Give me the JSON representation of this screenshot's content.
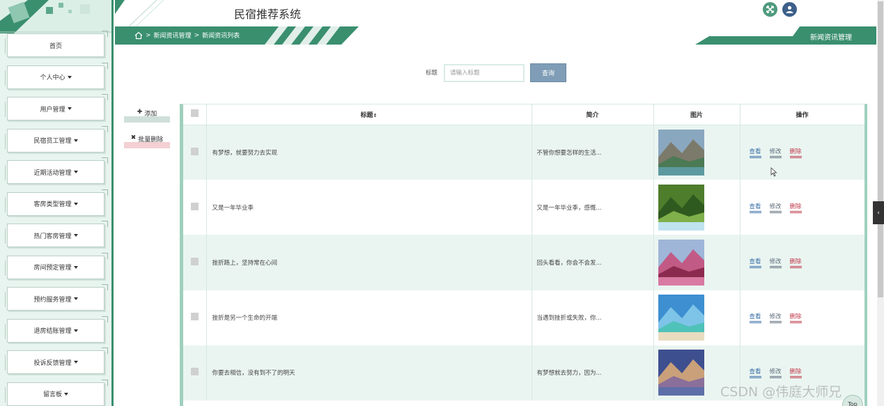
{
  "header": {
    "site_title": "民宿推荐系统",
    "section_label": "新闻资讯管理"
  },
  "breadcrumb": {
    "sep": ">",
    "items": [
      "新闻资讯管理",
      "新闻资讯列表"
    ]
  },
  "sidebar": {
    "items": [
      {
        "label": "首页",
        "has_dropdown": false
      },
      {
        "label": "个人中心",
        "has_dropdown": true
      },
      {
        "label": "用户管理",
        "has_dropdown": true
      },
      {
        "label": "民宿员工管理",
        "has_dropdown": true
      },
      {
        "label": "近期活动管理",
        "has_dropdown": true
      },
      {
        "label": "客房类型管理",
        "has_dropdown": true
      },
      {
        "label": "热门客房管理",
        "has_dropdown": true
      },
      {
        "label": "房间预定管理",
        "has_dropdown": true
      },
      {
        "label": "预约服务管理",
        "has_dropdown": true
      },
      {
        "label": "退房结账管理",
        "has_dropdown": true
      },
      {
        "label": "投诉反馈管理",
        "has_dropdown": true
      },
      {
        "label": "留言板",
        "has_dropdown": true
      }
    ]
  },
  "search": {
    "label": "标题",
    "placeholder": "请输入标题",
    "button": "查询"
  },
  "actions": {
    "add": "添加",
    "batch_delete": "批量删除"
  },
  "table": {
    "columns": [
      "标题",
      "简介",
      "图片",
      "操作"
    ],
    "sort_glyph": "⇕",
    "rows": [
      {
        "title": "有梦想，就要努力去实现",
        "intro": "不管你想要怎样的生活...",
        "image": "canyon-river"
      },
      {
        "title": "又是一年毕业季",
        "intro": "又是一年毕业季，感慨...",
        "image": "forest-waterfall"
      },
      {
        "title": "挫折路上，坚持常在心间",
        "intro": "回头看看，你会不会发...",
        "image": "pink-tree"
      },
      {
        "title": "挫折是另一个生命的开端",
        "intro": "当遇到挫折或失败，你...",
        "image": "tropical-beach"
      },
      {
        "title": "你要去相信，没有到不了的明天",
        "intro": "有梦想就去努力，因为...",
        "image": "mountain-lake"
      }
    ],
    "ops": {
      "view": "查看",
      "edit": "修改",
      "delete": "删除"
    }
  },
  "misc": {
    "watermark": "CSDN @伟庭大师兄",
    "top_button": "Top"
  },
  "colors": {
    "brand_green": "#3a8f6f",
    "search_button": "#7f9db6",
    "delete_red": "#c0394b"
  }
}
